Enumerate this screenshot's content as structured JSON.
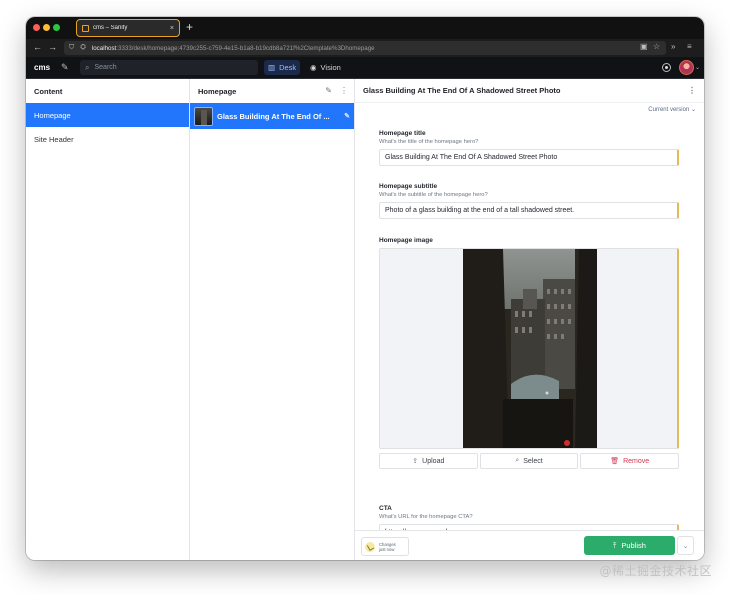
{
  "browser": {
    "tab_title": "cms – Sanity",
    "tab_close": "×",
    "new_tab": "+",
    "url_host": "localhost",
    "url_path": ":3333/desk/homepage;4739c255-c759-4e15-b1a8-b19cdb8a721f%2Ctemplate%3Dhomepage",
    "icons": [
      "back-arrow-icon",
      "forward-arrow-icon",
      "shield-icon",
      "settings-icon",
      "qr-icon",
      "star-icon",
      "chevron-double-icon",
      "menu-icon"
    ]
  },
  "toolbar": {
    "brand": "cms",
    "search_placeholder": "Search",
    "desk_label": "Desk",
    "vision_label": "Vision"
  },
  "content_pane": {
    "title": "Content",
    "items": [
      {
        "label": "Homepage",
        "selected": true
      },
      {
        "label": "Site Header",
        "selected": false
      }
    ]
  },
  "homepage_pane": {
    "title": "Homepage",
    "document_title": "Glass Building At The End Of ..."
  },
  "editor": {
    "title": "Glass Building At The End Of A Shadowed Street Photo",
    "version": "Current version ⌄",
    "fields": {
      "title": {
        "label": "Homepage title",
        "description": "What's the title of the homepage hero?",
        "value": "Glass Building At The End Of A Shadowed Street Photo"
      },
      "subtitle": {
        "label": "Homepage subtitle",
        "description": "What's the subtitle of the homepage hero?",
        "value": "Photo of a glass building at the end of a tall shadowed street."
      },
      "image": {
        "label": "Homepage image",
        "upload_label": "Upload",
        "select_label": "Select",
        "remove_label": "Remove"
      },
      "cta": {
        "label": "CTA",
        "description": "What's URL for the homepage CTA?",
        "value": "https://orangeman.dev"
      }
    },
    "footer": {
      "changes_line1": "Changes",
      "changes_line2": "just now",
      "publish_label": "Publish"
    }
  },
  "watermark": "@稀土掘金技术社区",
  "colors": {
    "accent": "#2276fc",
    "publish": "#2cac6a",
    "danger": "#d1394f",
    "tab_border": "#e8a321"
  }
}
